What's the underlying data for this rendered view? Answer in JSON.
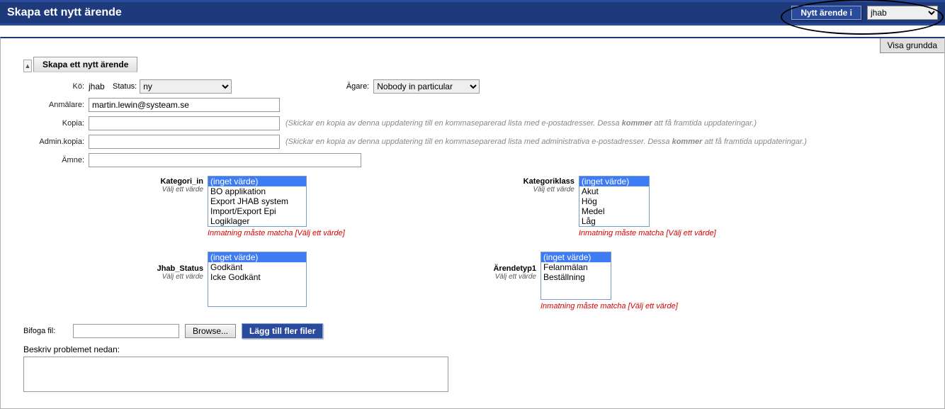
{
  "header": {
    "title": "Skapa ett nytt ärende",
    "new_button": "Nytt ärende i",
    "queue_select": "jhab"
  },
  "page": {
    "visa_button": "Visa grundda",
    "tab_label": "Skapa ett nytt ärende"
  },
  "form": {
    "ko_label": "Kö:",
    "ko_value": "jhab",
    "status_label": "Status:",
    "status_value": "ny",
    "owner_label": "Ägare:",
    "owner_value": "Nobody in particular",
    "anmalare_label": "Anmälare:",
    "anmalare_value": "martin.lewin@systeam.se",
    "kopia_label": "Kopia:",
    "kopia_value": "",
    "kopia_help_a": "(Skickar en kopia av denna uppdatering till en kommaseparerad lista med e-postadresser. Dessa ",
    "kopia_help_b": "kommer",
    "kopia_help_c": " att få framtida uppdateringar.)",
    "admin_label": "Admin.kopia:",
    "admin_value": "",
    "admin_help_a": "(Skickar en kopia av denna uppdatering till en kommaseparerad lista med administrativa e-postadresser. Dessa ",
    "admin_help_b": "kommer",
    "admin_help_c": " att få framtida uppdateringar.)",
    "amne_label": "Ämne:",
    "amne_value": ""
  },
  "fields": {
    "kategori_in": {
      "label": "Kategori_in",
      "sub": "Välj ett värde",
      "options": [
        "(inget värde)",
        "BO applikation",
        "Export JHAB system",
        "Import/Export Epi",
        "Logiklager"
      ],
      "error": "Inmatning måste matcha [Välj ett värde]"
    },
    "kategoriklass": {
      "label": "Kategoriklass",
      "sub": "Välj ett värde",
      "options": [
        "(inget värde)",
        "Akut",
        "Hög",
        "Medel",
        "Låg"
      ],
      "error": "Inmatning måste matcha [Välj ett värde]"
    },
    "jhab_status": {
      "label": "Jhab_Status",
      "sub": "Välj ett värde",
      "options": [
        "(inget värde)",
        "Godkänt",
        "Icke Godkänt"
      ]
    },
    "arendetyp": {
      "label": "Ärendetyp1",
      "sub": "Välj ett värde",
      "options": [
        "(inget värde)",
        "Felanmälan",
        "Beställning"
      ],
      "error": "Inmatning måste matcha [Välj ett värde]"
    }
  },
  "attach": {
    "label": "Bifoga fil:",
    "browse": "Browse...",
    "add_more": "Lägg till fler filer"
  },
  "describe": {
    "label": "Beskriv problemet nedan:",
    "value": ""
  }
}
